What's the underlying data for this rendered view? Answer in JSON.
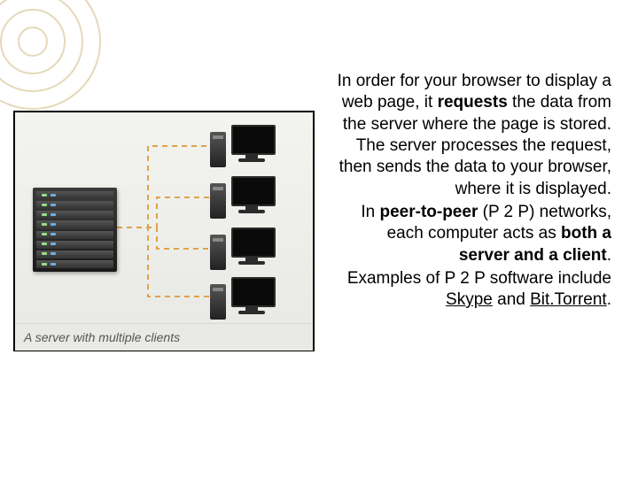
{
  "image": {
    "caption": "A server with multiple clients"
  },
  "paragraphs": {
    "p1_a": "In order for your browser to display a web page, it ",
    "p1_bold1": "requests",
    "p1_b": " the data from the server where the page is stored.  The server processes the request, then sends the data to your browser,  where it is displayed.",
    "p2_a": "In ",
    "p2_bold1": "peer-to-peer",
    "p2_b": " (P 2 P) networks,  each computer acts as ",
    "p2_bold2": "both a server and a client",
    "p2_c": ".",
    "p3_a": "Examples of P 2 P software include ",
    "p3_link1": "Skype",
    "p3_b": " and ",
    "p3_link2": "Bit.Torrent",
    "p3_c": "."
  }
}
